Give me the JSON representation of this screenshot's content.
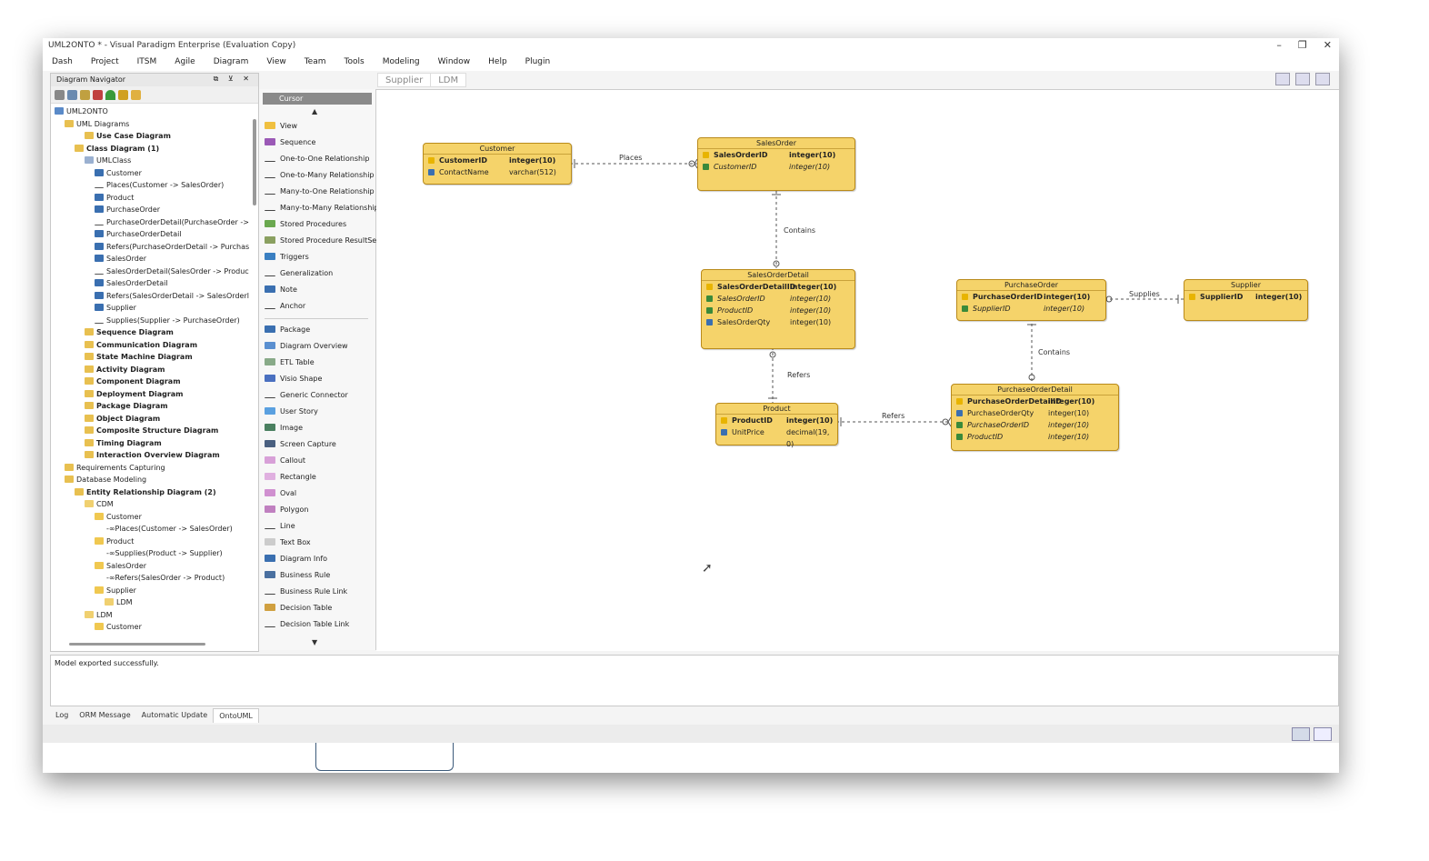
{
  "window": {
    "title": "UML2ONTO * - Visual Paradigm Enterprise (Evaluation Copy)",
    "controls": [
      "–",
      "❐",
      "✕"
    ]
  },
  "menu": [
    "Dash",
    "Project",
    "ITSM",
    "Agile",
    "Diagram",
    "View",
    "Team",
    "Tools",
    "Modeling",
    "Window",
    "Help",
    "Plugin"
  ],
  "navigator": {
    "title": "Diagram Navigator",
    "tree": [
      {
        "label": "UML2ONTO",
        "indent": 0,
        "bold": false,
        "icon": "project"
      },
      {
        "label": "UML Diagrams",
        "indent": 1,
        "bold": false,
        "icon": "folder"
      },
      {
        "label": "Use Case Diagram",
        "indent": 3,
        "bold": true,
        "icon": "diagram"
      },
      {
        "label": "Class Diagram (1)",
        "indent": 2,
        "bold": true,
        "icon": "diagram"
      },
      {
        "label": "UMLClass",
        "indent": 3,
        "bold": false,
        "icon": "class-diagram"
      },
      {
        "label": "Customer",
        "indent": 4,
        "bold": false,
        "icon": "class"
      },
      {
        "label": "Places(Customer -> SalesOrder)",
        "indent": 4,
        "bold": false,
        "icon": "line"
      },
      {
        "label": "Product",
        "indent": 4,
        "bold": false,
        "icon": "class"
      },
      {
        "label": "PurchaseOrder",
        "indent": 4,
        "bold": false,
        "icon": "class"
      },
      {
        "label": "PurchaseOrderDetail(PurchaseOrder ->",
        "indent": 4,
        "bold": false,
        "icon": "line"
      },
      {
        "label": "PurchaseOrderDetail",
        "indent": 4,
        "bold": false,
        "icon": "class"
      },
      {
        "label": "Refers(PurchaseOrderDetail -> Purchas",
        "indent": 4,
        "bold": false,
        "icon": "dep"
      },
      {
        "label": "SalesOrder",
        "indent": 4,
        "bold": false,
        "icon": "class"
      },
      {
        "label": "SalesOrderDetail(SalesOrder -> Produc",
        "indent": 4,
        "bold": false,
        "icon": "line"
      },
      {
        "label": "SalesOrderDetail",
        "indent": 4,
        "bold": false,
        "icon": "class"
      },
      {
        "label": "Refers(SalesOrderDetail -> SalesOrderl",
        "indent": 4,
        "bold": false,
        "icon": "dep"
      },
      {
        "label": "Supplier",
        "indent": 4,
        "bold": false,
        "icon": "class"
      },
      {
        "label": "Supplies(Supplier -> PurchaseOrder)",
        "indent": 4,
        "bold": false,
        "icon": "line"
      },
      {
        "label": "Sequence Diagram",
        "indent": 3,
        "bold": true,
        "icon": "diagram"
      },
      {
        "label": "Communication Diagram",
        "indent": 3,
        "bold": true,
        "icon": "diagram"
      },
      {
        "label": "State Machine Diagram",
        "indent": 3,
        "bold": true,
        "icon": "diagram"
      },
      {
        "label": "Activity Diagram",
        "indent": 3,
        "bold": true,
        "icon": "diagram"
      },
      {
        "label": "Component Diagram",
        "indent": 3,
        "bold": true,
        "icon": "diagram"
      },
      {
        "label": "Deployment Diagram",
        "indent": 3,
        "bold": true,
        "icon": "diagram"
      },
      {
        "label": "Package Diagram",
        "indent": 3,
        "bold": true,
        "icon": "diagram"
      },
      {
        "label": "Object Diagram",
        "indent": 3,
        "bold": true,
        "icon": "diagram"
      },
      {
        "label": "Composite Structure Diagram",
        "indent": 3,
        "bold": true,
        "icon": "diagram"
      },
      {
        "label": "Timing Diagram",
        "indent": 3,
        "bold": true,
        "icon": "diagram"
      },
      {
        "label": "Interaction Overview Diagram",
        "indent": 3,
        "bold": true,
        "icon": "diagram"
      },
      {
        "label": "Requirements Capturing",
        "indent": 1,
        "bold": false,
        "icon": "folder"
      },
      {
        "label": "Database Modeling",
        "indent": 1,
        "bold": false,
        "icon": "folder"
      },
      {
        "label": "Entity Relationship Diagram (2)",
        "indent": 2,
        "bold": true,
        "icon": "diagram"
      },
      {
        "label": "CDM",
        "indent": 3,
        "bold": false,
        "icon": "erd"
      },
      {
        "label": "Customer",
        "indent": 4,
        "bold": false,
        "icon": "entity"
      },
      {
        "label": "-∞Places(Customer -> SalesOrder)",
        "indent": 4,
        "bold": false,
        "icon": "none"
      },
      {
        "label": "Product",
        "indent": 4,
        "bold": false,
        "icon": "entity"
      },
      {
        "label": "-∞Supplies(Product -> Supplier)",
        "indent": 4,
        "bold": false,
        "icon": "none"
      },
      {
        "label": "SalesOrder",
        "indent": 4,
        "bold": false,
        "icon": "entity"
      },
      {
        "label": "-∞Refers(SalesOrder -> Product)",
        "indent": 4,
        "bold": false,
        "icon": "none"
      },
      {
        "label": "Supplier",
        "indent": 4,
        "bold": false,
        "icon": "entity"
      },
      {
        "label": "LDM",
        "indent": 5,
        "bold": false,
        "icon": "erd"
      },
      {
        "label": "LDM",
        "indent": 3,
        "bold": false,
        "icon": "erd"
      },
      {
        "label": "Customer",
        "indent": 4,
        "bold": false,
        "icon": "entity"
      }
    ]
  },
  "palette": {
    "selected": "Cursor",
    "items": [
      {
        "label": "View",
        "color": "#f0c040"
      },
      {
        "label": "Sequence",
        "color": "#9b59b6"
      },
      {
        "label": "One-to-One Relationship",
        "color": "none"
      },
      {
        "label": "One-to-Many Relationship",
        "color": "none"
      },
      {
        "label": "Many-to-One Relationship",
        "color": "none"
      },
      {
        "label": "Many-to-Many Relationship",
        "color": "none"
      },
      {
        "label": "Stored Procedures",
        "color": "#6aa84f"
      },
      {
        "label": "Stored Procedure ResultSet",
        "color": "#8aa060"
      },
      {
        "label": "Triggers",
        "color": "#3a7fc1"
      },
      {
        "label": "Generalization",
        "color": "none"
      },
      {
        "label": "Note",
        "color": "#3a6fb0"
      },
      {
        "label": "Anchor",
        "color": "none"
      },
      {
        "label": "Package",
        "color": "#3a6fb0"
      },
      {
        "label": "Diagram Overview",
        "color": "#5a8fd0"
      },
      {
        "label": "ETL Table",
        "color": "#88aa88"
      },
      {
        "label": "Visio Shape",
        "color": "#4a70c0"
      },
      {
        "label": "Generic Connector",
        "color": "none"
      },
      {
        "label": "User Story",
        "color": "#5aa0e0"
      },
      {
        "label": "Image",
        "color": "#4a8060"
      },
      {
        "label": "Screen Capture",
        "color": "#4a6080"
      },
      {
        "label": "Callout",
        "color": "#d8a0d8"
      },
      {
        "label": "Rectangle",
        "color": "#e0b0e0"
      },
      {
        "label": "Oval",
        "color": "#d090d0"
      },
      {
        "label": "Polygon",
        "color": "#c080c0"
      },
      {
        "label": "Line",
        "color": "none"
      },
      {
        "label": "Text Box",
        "color": "#cccccc"
      },
      {
        "label": "Diagram Info",
        "color": "#3a6fb0"
      },
      {
        "label": "Business Rule",
        "color": "#4a70a0"
      },
      {
        "label": "Business Rule Link",
        "color": "none"
      },
      {
        "label": "Decision Table",
        "color": "#d0a040"
      },
      {
        "label": "Decision Table Link",
        "color": "none"
      }
    ]
  },
  "breadcrumb": [
    "Supplier",
    "LDM"
  ],
  "diagram": {
    "entities": {
      "customer": {
        "name": "Customer",
        "cols": [
          {
            "name": "CustomerID",
            "type": "integer(10)",
            "kind": "pk"
          },
          {
            "name": "ContactName",
            "type": "varchar(512)",
            "kind": "col"
          }
        ]
      },
      "salesorder": {
        "name": "SalesOrder",
        "cols": [
          {
            "name": "SalesOrderID",
            "type": "integer(10)",
            "kind": "pk"
          },
          {
            "name": "CustomerID",
            "type": "integer(10)",
            "kind": "fk"
          }
        ]
      },
      "salesorderdetail": {
        "name": "SalesOrderDetail",
        "cols": [
          {
            "name": "SalesOrderDetailID",
            "type": "integer(10)",
            "kind": "pk"
          },
          {
            "name": "SalesOrderID",
            "type": "integer(10)",
            "kind": "fk"
          },
          {
            "name": "ProductID",
            "type": "integer(10)",
            "kind": "fk"
          },
          {
            "name": "SalesOrderQty",
            "type": "integer(10)",
            "kind": "col"
          }
        ]
      },
      "product": {
        "name": "Product",
        "cols": [
          {
            "name": "ProductID",
            "type": "integer(10)",
            "kind": "pk"
          },
          {
            "name": "UnitPrice",
            "type": "decimal(19, 0)",
            "kind": "col"
          }
        ]
      },
      "purchaseorder": {
        "name": "PurchaseOrder",
        "cols": [
          {
            "name": "PurchaseOrderID",
            "type": "integer(10)",
            "kind": "pk"
          },
          {
            "name": "SupplierID",
            "type": "integer(10)",
            "kind": "fk"
          }
        ]
      },
      "supplier": {
        "name": "Supplier",
        "cols": [
          {
            "name": "SupplierID",
            "type": "integer(10)",
            "kind": "pk"
          }
        ]
      },
      "purchaseorderdetail": {
        "name": "PurchaseOrderDetail",
        "cols": [
          {
            "name": "PurchaseOrderDetailID",
            "type": "integer(10)",
            "kind": "pk"
          },
          {
            "name": "PurchaseOrderQty",
            "type": "integer(10)",
            "kind": "col"
          },
          {
            "name": "PurchaseOrderID",
            "type": "integer(10)",
            "kind": "fk"
          },
          {
            "name": "ProductID",
            "type": "integer(10)",
            "kind": "fk"
          }
        ]
      }
    },
    "relationships": {
      "places": "Places",
      "contains1": "Contains",
      "refers1": "Refers",
      "refers2": "Refers",
      "supplies": "Supplies",
      "contains2": "Contains"
    }
  },
  "output": {
    "message": "Model exported successfully."
  },
  "bottom_tabs": [
    "Log",
    "ORM Message",
    "Automatic Update",
    "OntoUML"
  ],
  "active_tab": "OntoUML",
  "colors": {
    "entity_fill": "#f5d36a",
    "entity_border": "#b98a1a",
    "pk_key": "#e8b400",
    "fk_key": "#3a8a3a",
    "col_key": "#3a6fb0"
  }
}
